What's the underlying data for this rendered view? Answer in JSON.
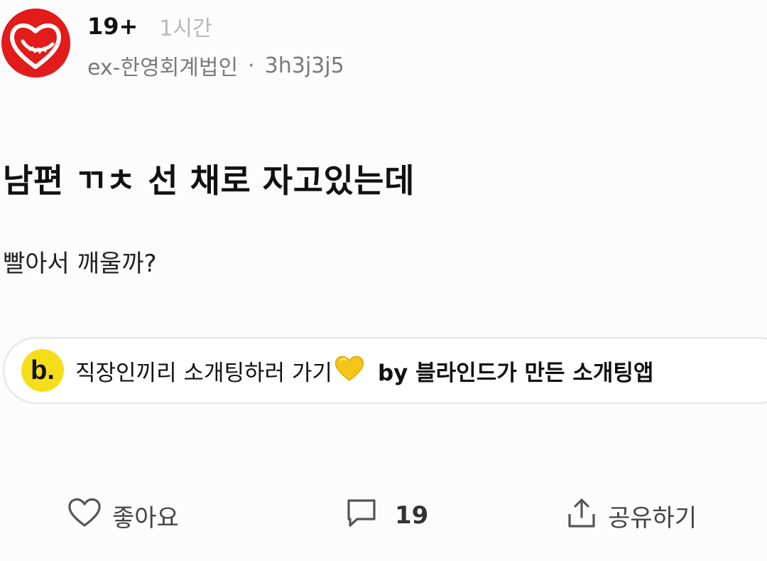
{
  "post": {
    "channel": "19+",
    "time": "1시간",
    "company": "ex-한영회계법인",
    "separator": "·",
    "author": "3h3j3j5",
    "title": "남편 ㄲㅊ 선 채로 자고있는데",
    "body": "빨아서 깨울까?"
  },
  "ad": {
    "logo_letter": "b.",
    "text": "직장인끼리 소개팅하러 가기",
    "heart_icon": "yellow-heart-icon",
    "suffix": "by 블라인드가 만든 소개팅앱",
    "logo_color": "#f6dd1a"
  },
  "actions": {
    "like_label": "좋아요",
    "comment_count": "19",
    "share_label": "공유하기"
  },
  "colors": {
    "avatar": "#e21b1b",
    "heart": "#f5c518",
    "muted": "#b8b8b8"
  }
}
